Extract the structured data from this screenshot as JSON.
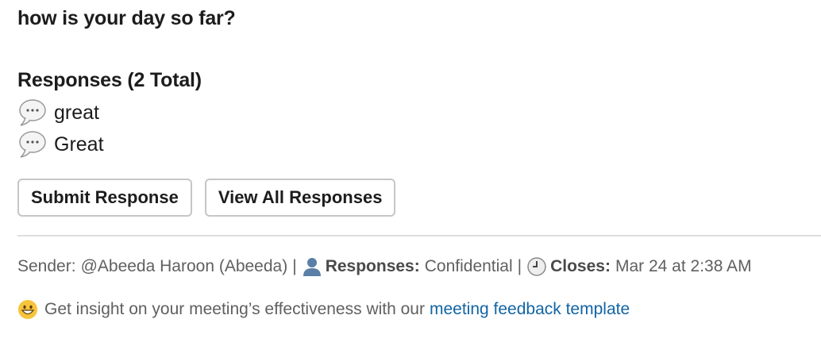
{
  "question": "how is your day so far?",
  "responses": {
    "header": "Responses (2 Total)",
    "items": [
      {
        "text": "great",
        "icon": "speech-balloon-icon"
      },
      {
        "text": "Great",
        "icon": "speech-balloon-icon"
      }
    ]
  },
  "buttons": {
    "submit": "Submit Response",
    "view_all": "View All Responses"
  },
  "meta": {
    "sender_label": "Sender:",
    "sender_value": "@Abeeda Haroon (Abeeda)",
    "separator": "|",
    "responses_label": "Responses:",
    "responses_value": "Confidential",
    "closes_label": "Closes:",
    "closes_value": "Mar 24 at 2:38 AM"
  },
  "footer": {
    "text": "Get insight on your meeting’s effectiveness with our",
    "link": "meeting feedback template",
    "emoji": "grinning-face"
  },
  "colors": {
    "link": "#1264a3",
    "muted_text": "#616061",
    "button_border": "#c6c6c6",
    "divider": "#dddddd"
  }
}
